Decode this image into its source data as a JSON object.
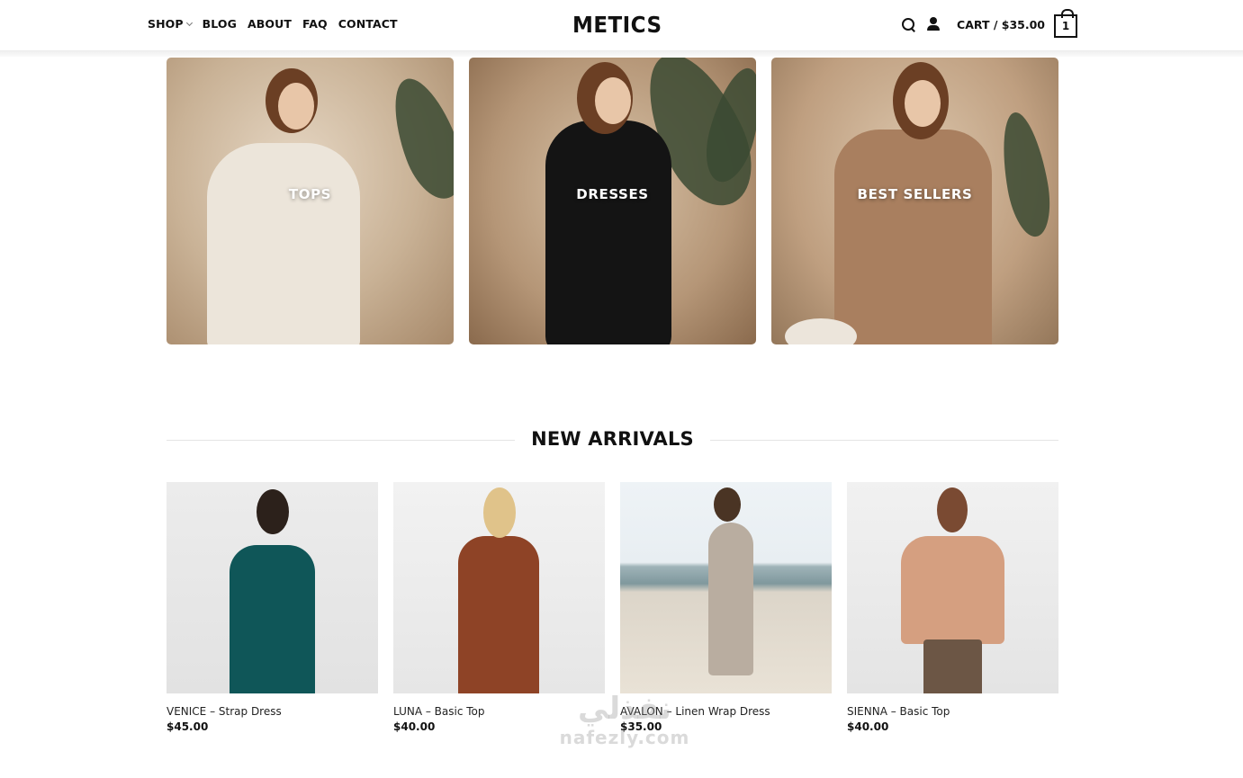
{
  "header": {
    "nav": [
      {
        "label": "SHOP",
        "has_dropdown": true
      },
      {
        "label": "BLOG"
      },
      {
        "label": "ABOUT"
      },
      {
        "label": "FAQ"
      },
      {
        "label": "CONTACT"
      }
    ],
    "logo": "METICS",
    "cart_label": "CART / $35.00",
    "cart_count": "1"
  },
  "categories": [
    {
      "label": "TOPS"
    },
    {
      "label": "DRESSES"
    },
    {
      "label": "BEST SELLERS"
    }
  ],
  "new_arrivals": {
    "title": "NEW ARRIVALS",
    "products": [
      {
        "name": "VENICE – Strap Dress",
        "price": "$45.00"
      },
      {
        "name": "LUNA – Basic Top",
        "price": "$40.00"
      },
      {
        "name": "AVALON – Linen Wrap Dress",
        "price": "$35.00"
      },
      {
        "name": "SIENNA – Basic Top",
        "price": "$40.00"
      }
    ]
  },
  "watermark": {
    "arabic": "نفذلي",
    "latin": "nafezly.com"
  }
}
